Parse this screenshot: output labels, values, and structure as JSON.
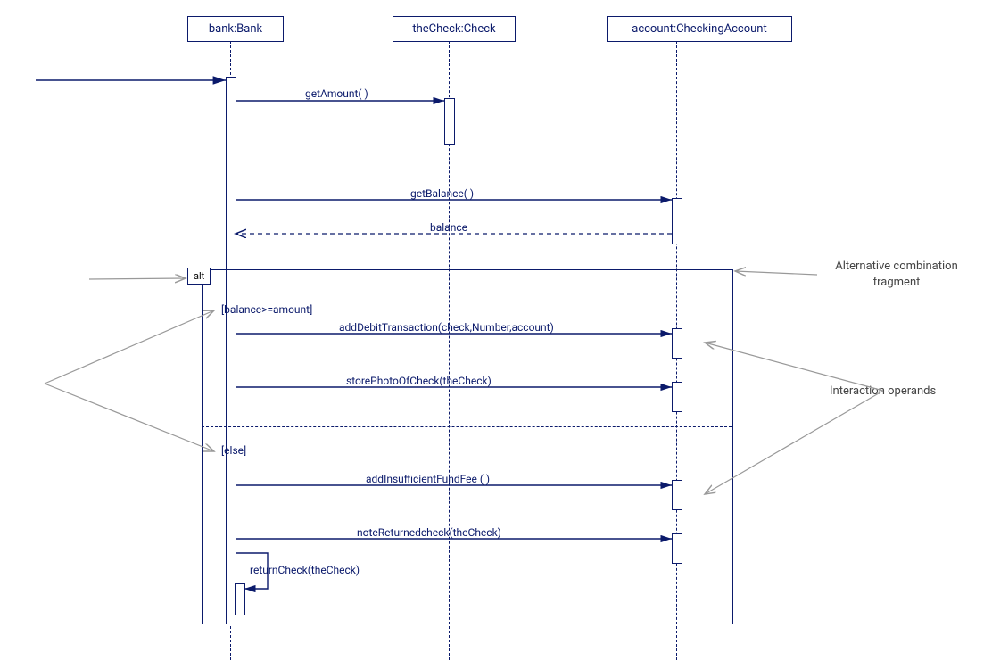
{
  "participants": {
    "bank": "bank:Bank",
    "check": "theCheck:Check",
    "account": "account:CheckingAccount"
  },
  "messages": {
    "getAmount": "getAmount( )",
    "getBalance": "getBalance( )",
    "balance": "balance",
    "addDebit": "addDebitTransaction(check,Number,account)",
    "storePhoto": "storePhotoOfCheck(theCheck)",
    "addFee": "addInsufficientFundFee ( )",
    "noteReturned": "noteReturnedcheck(theCheck)",
    "returnCheck": "returnCheck(theCheck)"
  },
  "fragment": {
    "operator": "alt",
    "guard1": "[balance>=amount]",
    "guard2": "[else]"
  },
  "annotations": {
    "altFrag": "Alternative combination fragment",
    "operands": "Interaction operands"
  },
  "chart_data": {
    "type": "sequence_diagram",
    "participants": [
      {
        "id": "bank",
        "label": "bank:Bank"
      },
      {
        "id": "check",
        "label": "theCheck:Check"
      },
      {
        "id": "account",
        "label": "account:CheckingAccount"
      }
    ],
    "incoming_message": {
      "to": "bank"
    },
    "messages": [
      {
        "from": "bank",
        "to": "check",
        "label": "getAmount( )",
        "type": "sync"
      },
      {
        "from": "bank",
        "to": "account",
        "label": "getBalance( )",
        "type": "sync"
      },
      {
        "from": "account",
        "to": "bank",
        "label": "balance",
        "type": "return"
      }
    ],
    "combined_fragment": {
      "operator": "alt",
      "operands": [
        {
          "guard": "[balance>=amount]",
          "messages": [
            {
              "from": "bank",
              "to": "account",
              "label": "addDebitTransaction(check,Number,account)",
              "type": "sync"
            },
            {
              "from": "bank",
              "to": "account",
              "label": "storePhotoOfCheck(theCheck)",
              "type": "sync"
            }
          ]
        },
        {
          "guard": "[else]",
          "messages": [
            {
              "from": "bank",
              "to": "account",
              "label": "addInsufficientFundFee ( )",
              "type": "sync"
            },
            {
              "from": "bank",
              "to": "account",
              "label": "noteReturnedcheck(theCheck)",
              "type": "sync"
            },
            {
              "from": "bank",
              "to": "bank",
              "label": "returnCheck(theCheck)",
              "type": "self"
            }
          ]
        }
      ]
    },
    "annotations": [
      {
        "label": "Alternative combination fragment",
        "targets": [
          "alt-frame"
        ]
      },
      {
        "label": "Interaction operands",
        "targets": [
          "operand1",
          "operand2"
        ]
      }
    ]
  }
}
